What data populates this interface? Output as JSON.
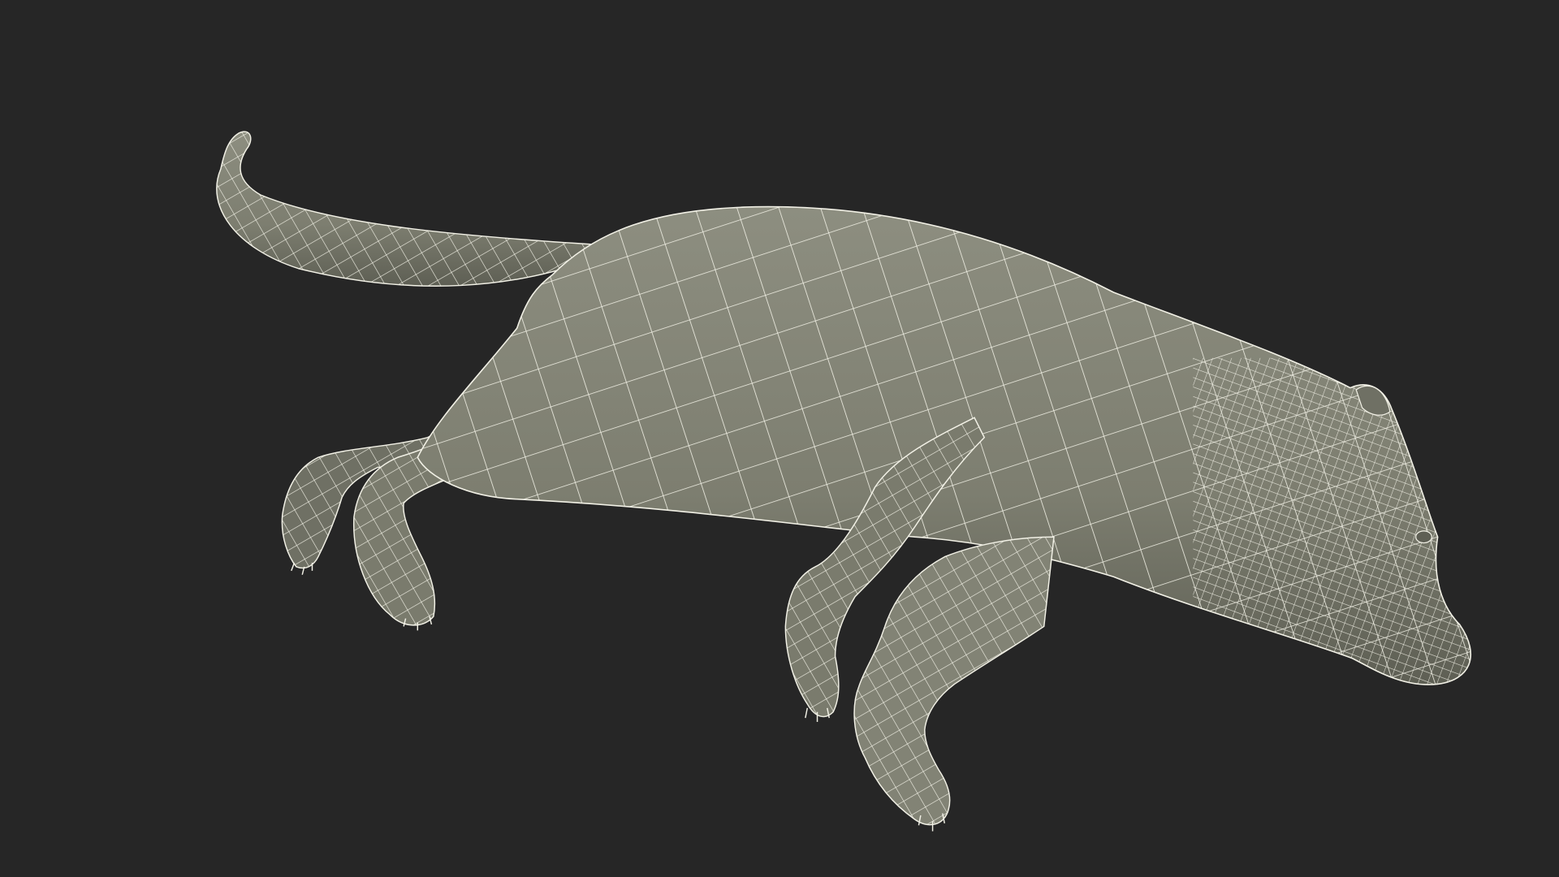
{
  "scene": {
    "subject": "animal-wireframe-model",
    "colors": {
      "background": "#262626",
      "surface": "#7d7e70",
      "surface_light": "#8d8e80",
      "surface_shadow": "#5e5f54",
      "wire": "#f2f1e6"
    }
  }
}
